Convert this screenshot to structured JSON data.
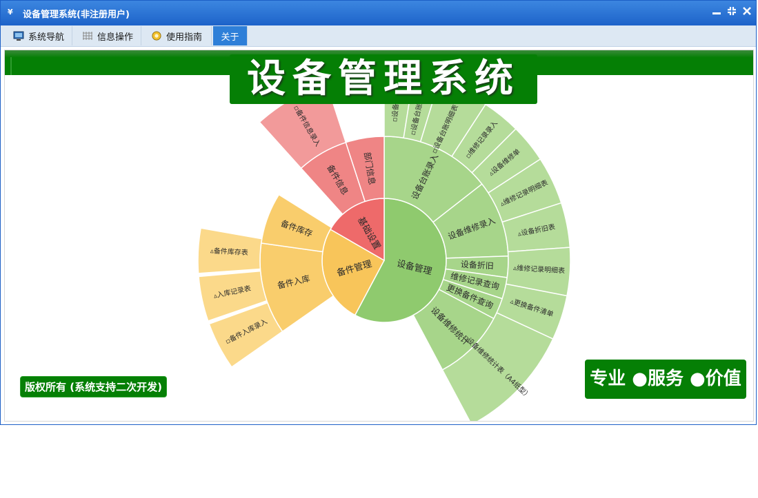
{
  "window": {
    "title": "设备管理系统(非注册用户)",
    "app_icon": "¥",
    "controls": {
      "minimize": "▬",
      "restore": "⛶",
      "close": "✕"
    }
  },
  "tabs": [
    {
      "label": "系统导航",
      "icon": "monitor-icon"
    },
    {
      "label": "信息操作",
      "icon": "grid-icon"
    },
    {
      "label": "使用指南",
      "icon": "help-icon"
    },
    {
      "label": "关于",
      "icon": ""
    }
  ],
  "active_tab": 3,
  "banner": {
    "text": "设备管理系统"
  },
  "footer": {
    "copyright": "版权所有 (系统支持二次开发)",
    "slogan": "专业 ●服务 ●价值"
  },
  "colors": {
    "titlebar": "#1d63c9",
    "accent_green": "#057f05",
    "equipment": "#8fca6e",
    "spare": "#f8c55a",
    "basic": "#ee6a6a"
  },
  "chart_data": {
    "type": "sunburst",
    "rings": [
      [
        {
          "label": "设备管理",
          "group": "equipment"
        },
        {
          "label": "备件管理",
          "group": "spare"
        },
        {
          "label": "基础设置",
          "group": "basic"
        }
      ],
      [
        {
          "label": "设备台账录入",
          "group": "equipment"
        },
        {
          "label": "设备维修录入",
          "group": "equipment"
        },
        {
          "label": "设备折旧",
          "group": "equipment"
        },
        {
          "label": "维修记录查询",
          "group": "equipment"
        },
        {
          "label": "更换备件查询",
          "group": "equipment"
        },
        {
          "label": "设备维修统计",
          "group": "equipment"
        },
        {
          "label": "备件入库",
          "group": "spare"
        },
        {
          "label": "备件库存",
          "group": "spare"
        },
        {
          "label": "备件信息",
          "group": "basic"
        },
        {
          "label": "部门信息",
          "group": "basic"
        }
      ],
      [
        {
          "label": "▫设备台账",
          "group": "equipment"
        },
        {
          "label": "▫设备台账明细表",
          "group": "equipment"
        },
        {
          "label": "▫设备台账明细表（二）",
          "group": "equipment"
        },
        {
          "label": "▫维修记录录入",
          "group": "equipment"
        },
        {
          "label": "▵设备维修单",
          "group": "equipment"
        },
        {
          "label": "▵维修记录明细表",
          "group": "equipment"
        },
        {
          "label": "▵设备折旧表",
          "group": "equipment"
        },
        {
          "label": "▵维修记录明细表",
          "group": "equipment"
        },
        {
          "label": "▵更换备件清单",
          "group": "equipment"
        },
        {
          "label": "▫设备维修统计表（A4纸型）",
          "group": "equipment"
        },
        {
          "label": "▫备件入库录入",
          "group": "spare"
        },
        {
          "label": "▵入库记录表",
          "group": "spare"
        },
        {
          "label": "▵备件库存表",
          "group": "spare"
        },
        {
          "label": "▫备件信息录入",
          "group": "basic"
        }
      ]
    ]
  }
}
